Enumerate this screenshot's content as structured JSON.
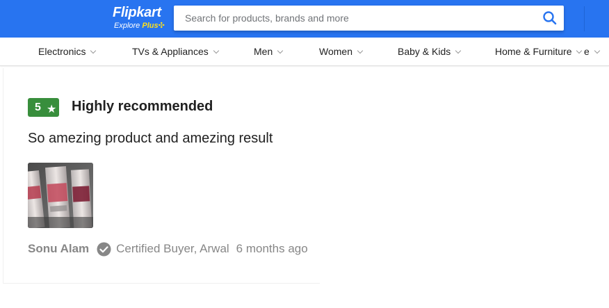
{
  "header": {
    "logo_name": "Flipkart",
    "logo_sub": "Explore",
    "logo_plus": "Plus",
    "search_placeholder": "Search for products, brands and more",
    "brand_color": "#2874f0",
    "logo_accent_color": "#ffe11b"
  },
  "categories": [
    {
      "label": "Electronics"
    },
    {
      "label": "TVs & Appliances"
    },
    {
      "label": "Men"
    },
    {
      "label": "Women"
    },
    {
      "label": "Baby & Kids"
    },
    {
      "label": "Home & Furniture"
    },
    {
      "label": "e"
    }
  ],
  "review": {
    "rating": "5",
    "rating_star": "★",
    "rating_color": "#388e3c",
    "title": "Highly recommended",
    "text": "So amezing product and amezing result",
    "reviewer_name": "Sonu Alam",
    "certified": "Certified Buyer, Arwal",
    "time_ago": "6 months ago",
    "image_icon": "product-photo-thumbnail",
    "verified_icon": "check-circle-icon"
  }
}
